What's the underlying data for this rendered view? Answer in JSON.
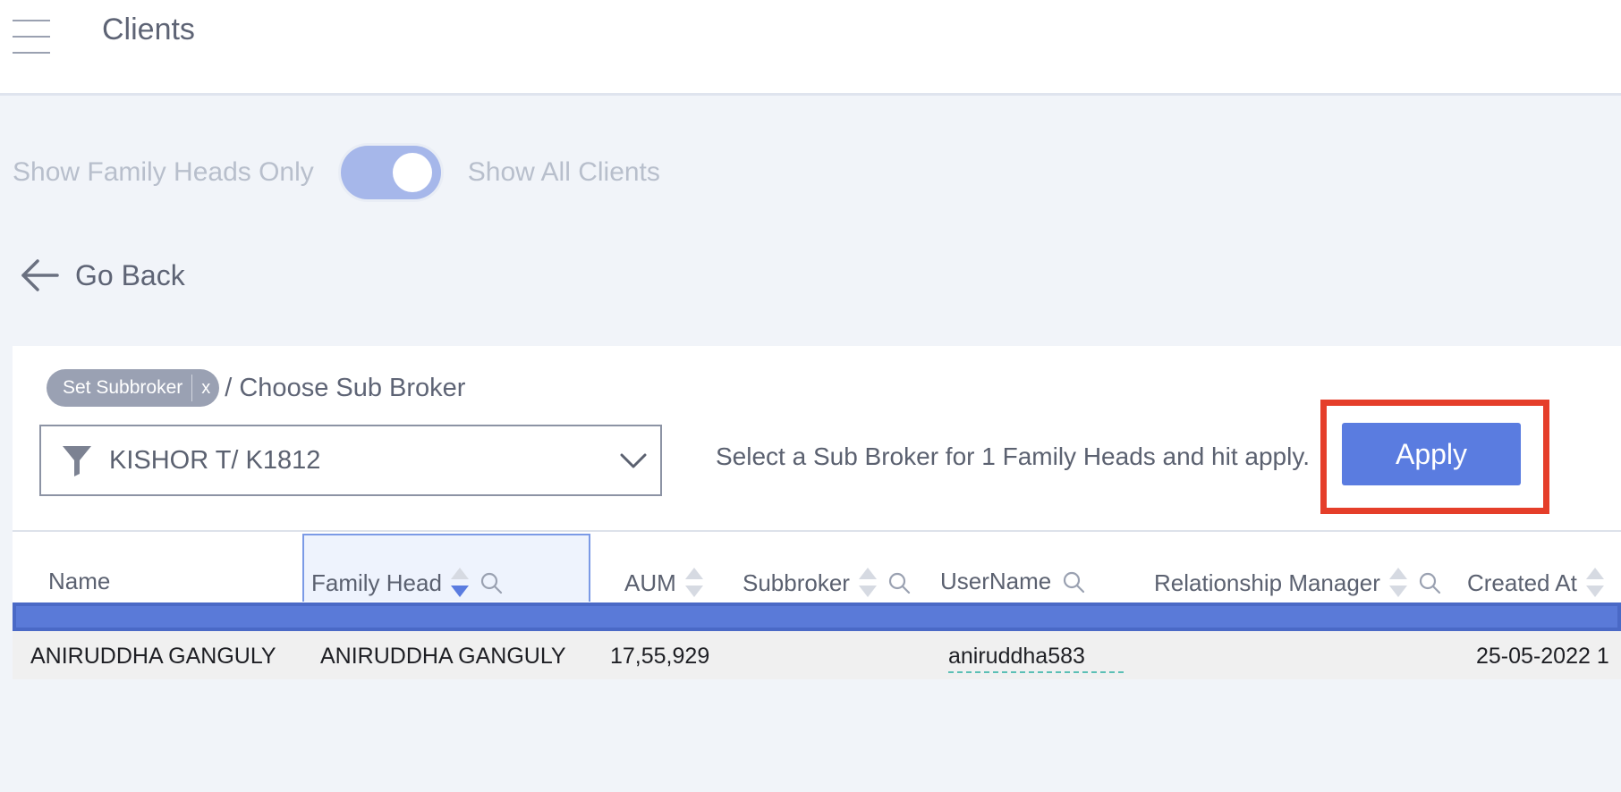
{
  "header": {
    "title": "Clients"
  },
  "toggle": {
    "left_label": "Show Family Heads Only",
    "right_label": "Show All Clients"
  },
  "nav": {
    "go_back": "Go Back"
  },
  "filter": {
    "chip_label": "Set Subbroker",
    "chip_close": "x",
    "breadcrumb": "/ Choose Sub Broker",
    "selected": "KISHOR T/ K1812",
    "hint": "Select a Sub Broker for 1 Family Heads and hit apply.",
    "apply_label": "Apply"
  },
  "table": {
    "columns": [
      "Name",
      "Family Head",
      "AUM",
      "Subbroker",
      "UserName",
      "Relationship Manager",
      "Created At"
    ],
    "rows": [
      [
        "ANIRUDDHA GANGULY",
        "ANIRUDDHA GANGULY",
        "17,55,929",
        "",
        "aniruddha583",
        "",
        "25-05-2022 1"
      ]
    ]
  },
  "colors": {
    "accent": "#5a7ce0",
    "highlight": "#e53e2a",
    "toggle": "#a6b7ea"
  }
}
